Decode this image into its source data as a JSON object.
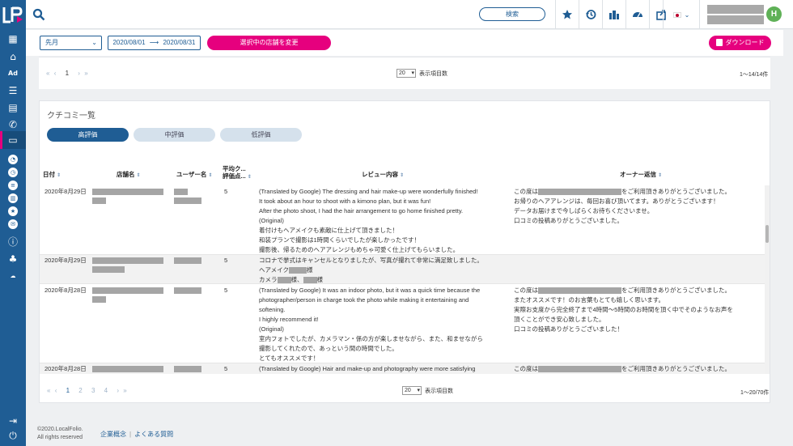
{
  "header": {
    "search_button": "検索",
    "user_initial": "H"
  },
  "filter": {
    "period": "先月",
    "date_from": "2020/08/01",
    "date_arrow": "⟶",
    "date_to": "2020/08/31",
    "change_store_button": "選択中の店舗を変更",
    "download_button": "ダウンロード"
  },
  "top_pager": {
    "current_page": "1",
    "per_page": "20",
    "per_page_label": "表示項目数",
    "range": "1〜14/14件"
  },
  "reviews": {
    "title": "クチコミ一覧",
    "tabs": [
      "高評価",
      "中評価",
      "低評価"
    ],
    "columns": {
      "date": "日付",
      "store": "店舗名",
      "user": "ユーザー名",
      "rating_l1": "平均ク...",
      "rating_l2": "評価点...",
      "content": "レビュー内容",
      "owner": "オーナー返信"
    },
    "rows": [
      {
        "date": "2020年8月29日",
        "rating": "5",
        "content": "(Translated by Google) The dressing and hair make-up were wonderfully finished!\nIt took about an hour to shoot with a kimono plan, but it was fun!\nAfter the photo shoot, I had the hair arrangement to go home finished pretty.\n(Original)\n着付けもヘアメイクも素敵に仕上げて頂きました！\n和装プランで撮影は1時間くらいでしたが楽しかったです！\n撮影後、帰るためのヘアアレンジもめちゃ可愛く仕上げてもらいました。",
        "owner_prefix": "この度は",
        "owner_suffix": "をご利用頂きありがとうございました。",
        "owner_rest": "お帰りのヘアアレンジは、毎回お喜び頂いてます。ありがとうございます！\nデータお届けまで今しばらくお待ちくださいませ。\n口コミの投稿ありがとうございました。"
      },
      {
        "date": "2020年8月29日",
        "rating": "5",
        "content_line1": "コロナで挙式はキャンセルとなりましたが、写真が撮れて非常に満足致しました。",
        "content_l2_prefix": "ヘアメイク",
        "content_l2_suffix": "様",
        "content_l3_prefix": "カメラ",
        "content_l3_mid": "様、",
        "content_l3_suffix": "様"
      },
      {
        "date": "2020年8月28日",
        "rating": "5",
        "content": "(Translated by Google) It was an indoor photo, but it was a quick time because the\nphotographer/person in charge took the photo while making it entertaining and\nsoftening.\nI highly recommend it!\n(Original)\n室内フォトでしたが、カメラマン・係の方が楽しませながら、また、和ませながら\n撮影してくれたので、あっという間の時間でした。\nとてもオススメです！",
        "owner_prefix": "この度は",
        "owner_suffix": "をご利用頂きありがとうございました。",
        "owner_rest": "またオススメです！のお言葉もとても嬉しく思います。\n実際お支度から完全終了まで4時間〜5時間のお時間を頂く中でそのようなお声を\n頂くことができ安心致しました。\n口コミの投稿ありがとうございました！"
      },
      {
        "date": "2020年8月28日",
        "rating": "5",
        "content": "(Translated by Google) Hair and make-up and photography were more satisfying",
        "owner_prefix": "この度は",
        "owner_suffix": "をご利用頂きありがとうございました。"
      }
    ],
    "pager": {
      "pages": [
        "1",
        "2",
        "3",
        "4"
      ],
      "per_page": "20",
      "per_page_label": "表示項目数",
      "range": "1〜20/70件"
    }
  },
  "footer": {
    "copyright_l1": "©2020.LocalFolio.",
    "copyright_l2": "All rights reserved",
    "link_company": "企業概念",
    "link_faq": "よくある質問"
  },
  "colors": {
    "brand_blue": "#1f5d94",
    "accent_pink": "#e6007e",
    "avatar_green": "#5fb157"
  }
}
